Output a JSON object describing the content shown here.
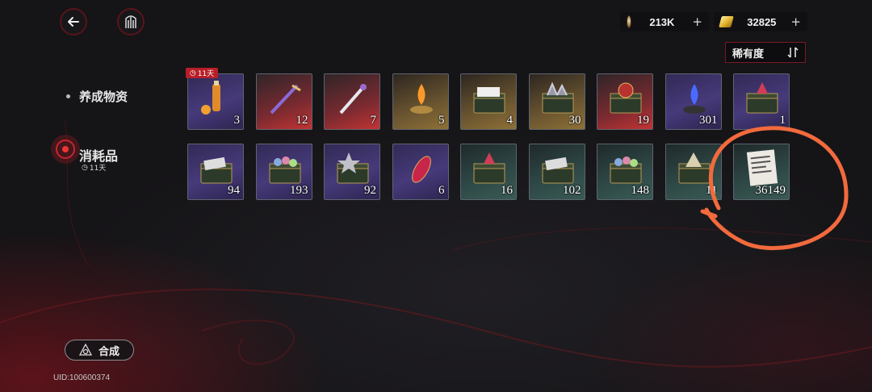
{
  "header": {
    "currencies": [
      {
        "icon": "coin-icon",
        "amount": "213K",
        "plus": "+"
      },
      {
        "icon": "gold-bar-icon",
        "amount": "32825",
        "plus": "+"
      }
    ],
    "sort_label": "稀有度"
  },
  "sidebar": {
    "items": [
      {
        "label": "养成物资"
      },
      {
        "label": "消耗品",
        "sub": "11天"
      }
    ],
    "synthesize_label": "合成",
    "uid": "UID:100600374"
  },
  "inventory": {
    "timer_badge": "11天",
    "items": [
      {
        "name": "orange-drink-item",
        "count": "3",
        "rarity": "purple"
      },
      {
        "name": "purple-sword-item",
        "count": "12",
        "rarity": "red"
      },
      {
        "name": "red-dagger-item",
        "count": "7",
        "rarity": "red"
      },
      {
        "name": "flame-lamp-item",
        "count": "5",
        "rarity": "gold"
      },
      {
        "name": "document-chest-item",
        "count": "4",
        "rarity": "gold"
      },
      {
        "name": "crystal-chest-item",
        "count": "30",
        "rarity": "gold"
      },
      {
        "name": "badge-chest-item",
        "count": "19",
        "rarity": "red"
      },
      {
        "name": "blue-flame-lamp-item",
        "count": "301",
        "rarity": "purple"
      },
      {
        "name": "red-crystal-chest-item",
        "count": "1",
        "rarity": "purple"
      },
      {
        "name": "letter-chest-item",
        "count": "94",
        "rarity": "purple"
      },
      {
        "name": "gem-chest-item",
        "count": "193",
        "rarity": "purple"
      },
      {
        "name": "star-badge-chest-item",
        "count": "92",
        "rarity": "purple"
      },
      {
        "name": "red-amulet-item",
        "count": "6",
        "rarity": "purple"
      },
      {
        "name": "red-crystal-chest-item",
        "count": "16",
        "rarity": "green"
      },
      {
        "name": "letter-chest-item",
        "count": "102",
        "rarity": "green"
      },
      {
        "name": "gem-chest-item",
        "count": "148",
        "rarity": "green"
      },
      {
        "name": "pyramid-chest-item",
        "count": "11",
        "rarity": "green"
      },
      {
        "name": "newspaper-item",
        "count": "36149",
        "rarity": "green"
      }
    ]
  },
  "colors": {
    "accent_red": "#b81e28",
    "annotation_orange": "#f26a3d"
  }
}
